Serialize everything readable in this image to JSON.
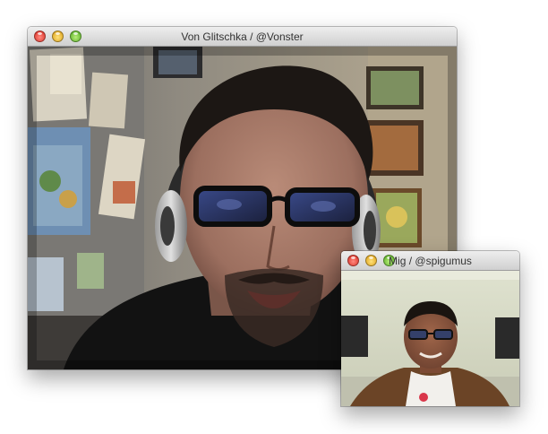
{
  "main_window": {
    "title": "Von Glitschka  /  @Vonster"
  },
  "mini_window": {
    "title": "Mig  /  @spigumus"
  },
  "colors": {
    "close": "#d8261c",
    "minimize": "#d99a10",
    "zoom": "#4ea81c"
  }
}
